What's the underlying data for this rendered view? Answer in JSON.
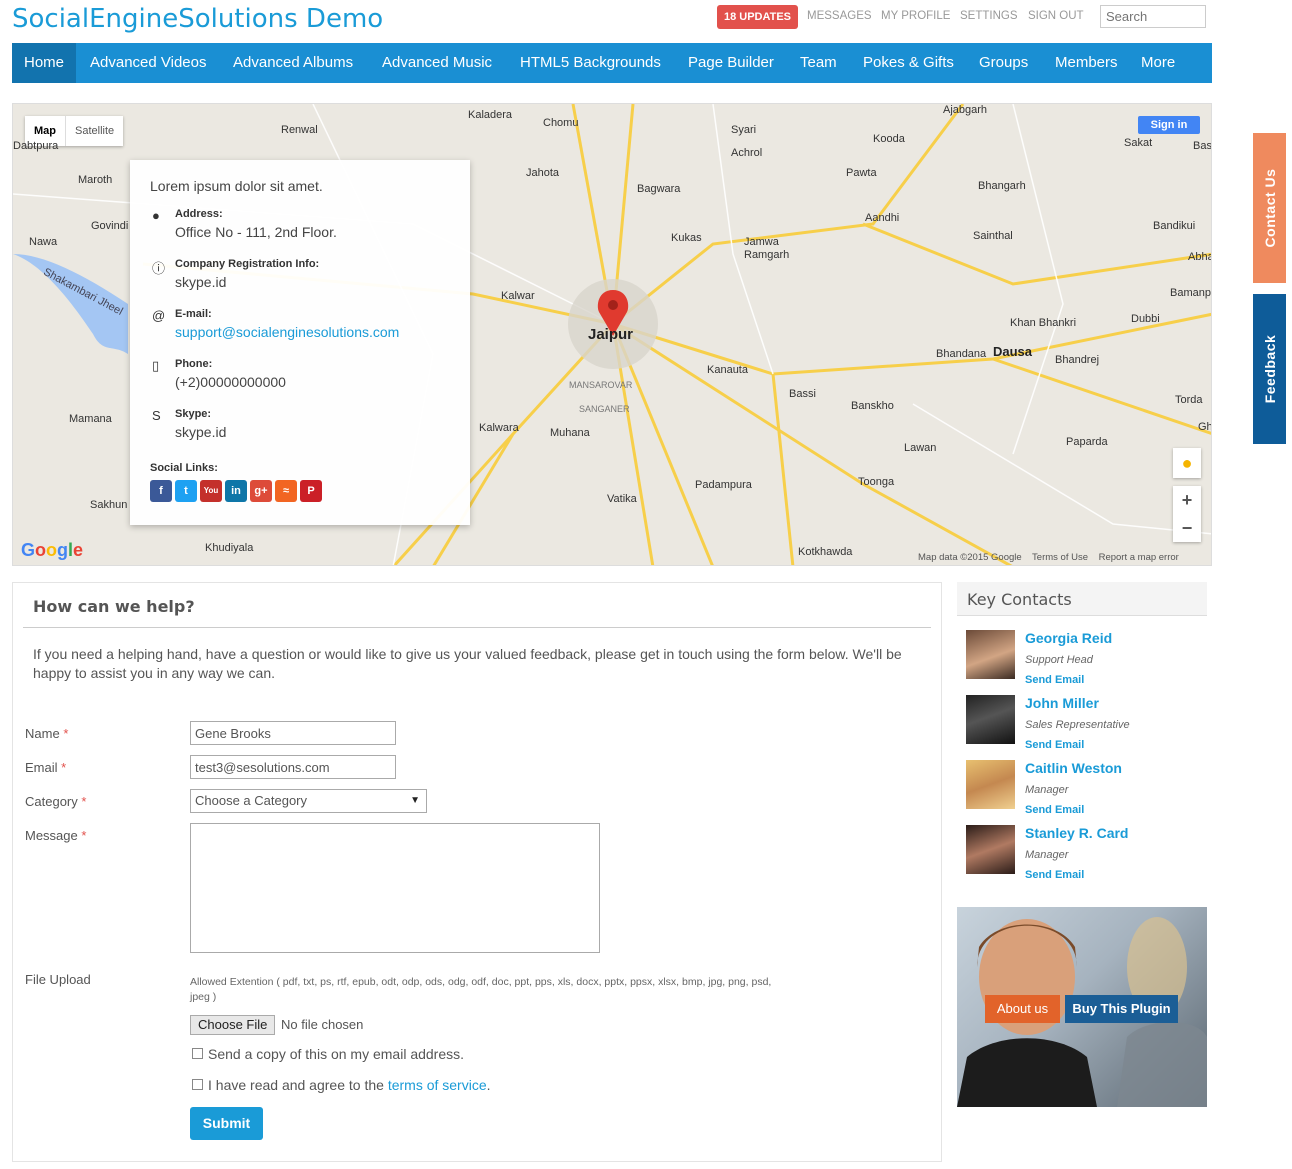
{
  "header": {
    "site_title": "SocialEngineSolutions Demo",
    "updates_badge": "18 UPDATES",
    "links": [
      "MESSAGES",
      "MY PROFILE",
      "SETTINGS",
      "SIGN OUT"
    ],
    "search_placeholder": "Search"
  },
  "nav": {
    "items": [
      "Home",
      "Advanced Videos",
      "Advanced Albums",
      "Advanced Music",
      "HTML5 Backgrounds",
      "Page Builder",
      "Team",
      "Pokes & Gifts",
      "Groups",
      "Members",
      "More"
    ],
    "active": "Home"
  },
  "map": {
    "type_buttons": [
      "Map",
      "Satellite"
    ],
    "sign_in": "Sign in",
    "city": "Jaipur",
    "places": [
      "Kaladera",
      "Chomu",
      "Renwal",
      "Syari",
      "Achrol",
      "Ajabgarh",
      "Kooda",
      "Sakat",
      "Maroth",
      "Jahota",
      "Bagwara",
      "Pawta",
      "Bhangarh",
      "Govindi",
      "Nawa",
      "Kukas",
      "Jamwa Ramgarh",
      "Aandhi",
      "Sainthal",
      "Bandikui",
      "Abha",
      "Bamanpur",
      "Dubbi",
      "Khan Bhankri",
      "Kalwar",
      "Dausa",
      "Bhandana",
      "Bhandrej",
      "Kanauta",
      "Bassi",
      "Banskho",
      "Torda",
      "Mamana",
      "Kalwara",
      "Muhana",
      "Lawan",
      "Paparda",
      "Toonga",
      "Padampura",
      "Vatika",
      "Sakhun",
      "Khudiyala",
      "Kotkhawda",
      "Shakambari Jheel",
      "Dabtpura",
      "Ghad",
      "Baswa",
      "Mansarovar",
      "Sanganer"
    ],
    "footer": [
      "Map data ©2015 Google",
      "Terms of Use",
      "Report a map error"
    ],
    "zoom_in": "+",
    "zoom_out": "−",
    "google_logo": "Google"
  },
  "info_card": {
    "intro": "Lorem ipsum dolor sit amet.",
    "address_label": "Address:",
    "address": "Office No - 111, 2nd Floor.",
    "company_label": "Company Registration Info:",
    "company": "skype.id",
    "email_label": "E-mail:",
    "email": "support@socialenginesolutions.com",
    "phone_label": "Phone:",
    "phone": "(+2)00000000000",
    "skype_label": "Skype:",
    "skype": "skype.id",
    "social_label": "Social Links:",
    "social": [
      "facebook-icon",
      "twitter-icon",
      "youtube-icon",
      "linkedin-icon",
      "google-plus-icon",
      "rss-icon",
      "pinterest-icon"
    ]
  },
  "side_tabs": {
    "contact": "Contact Us",
    "feedback": "Feedback"
  },
  "form": {
    "title": "How can we help?",
    "intro": "If you need a helping hand, have a question or would like to give us your valued feedback, please get in touch using the form below. We'll be happy to assist you in any way we can.",
    "name_label": "Name",
    "name_value": "Gene Brooks",
    "email_label": "Email",
    "email_value": "test3@sesolutions.com",
    "category_label": "Category",
    "category_value": "Choose a Category",
    "message_label": "Message",
    "message_value": "",
    "file_label": "File Upload",
    "allowed": "Allowed Extention ( pdf, txt, ps, rtf, epub, odt, odp, ods, odg, odf, doc, ppt, pps, xls, docx, pptx, ppsx, xlsx, bmp, jpg, png, psd, jpeg )",
    "choose_file": "Choose File",
    "no_file": "No file chosen",
    "copy_text": "Send a copy of this on my email address.",
    "agree_text": "I have read and agree to the",
    "terms_link": "terms of service",
    "terms_end": ".",
    "submit": "Submit",
    "required_mark": "*"
  },
  "key_contacts": {
    "title": "Key Contacts",
    "send_email": "Send Email",
    "people": [
      {
        "name": "Georgia Reid",
        "role": "Support Head"
      },
      {
        "name": "John Miller",
        "role": "Sales Representative"
      },
      {
        "name": "Caitlin Weston",
        "role": "Manager"
      },
      {
        "name": "Stanley R. Card",
        "role": "Manager"
      }
    ]
  },
  "promo": {
    "about": "About us",
    "buy": "Buy This Plugin"
  },
  "colors": {
    "accent": "#1a9bd7",
    "nav": "#1a8fd3",
    "badge": "#e2514c",
    "contact_tab": "#ef8a5e",
    "feedback_tab": "#0e5c99"
  }
}
